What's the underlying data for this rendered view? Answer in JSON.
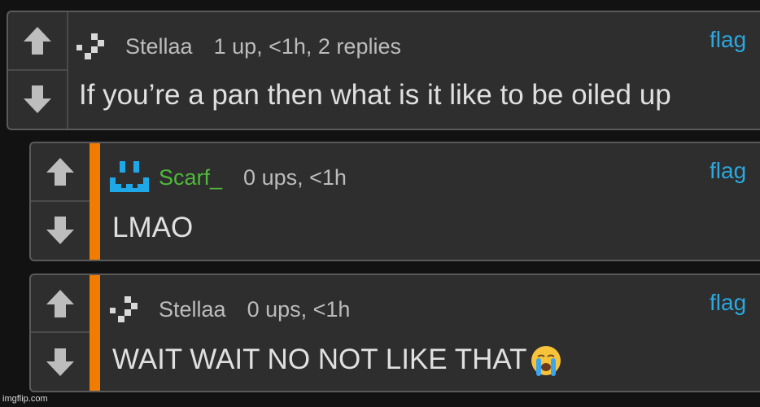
{
  "comments": [
    {
      "username": "Stellaa",
      "meta": "1 up, <1h, 2 replies",
      "flag": "flag",
      "text": "If you’re a pan then what is it like to be oiled up",
      "username_color": "#bcbcbc"
    },
    {
      "username": "Scarf_",
      "meta": "0 ups, <1h",
      "flag": "flag",
      "text": "LMAO",
      "username_color": "#4fb93a"
    },
    {
      "username": "Stellaa",
      "meta": "0 ups, <1h",
      "flag": "flag",
      "text": "WAIT WAIT NO NOT LIKE THAT",
      "emoji": "loudly-crying-face",
      "username_color": "#bcbcbc"
    }
  ],
  "icons": {
    "upvote": "arrow-up-icon",
    "downvote": "arrow-down-icon"
  },
  "colors": {
    "background": "#121212",
    "panel": "#2e2e2e",
    "reply_bar": "#f07c00",
    "flag": "#2aa8e0"
  },
  "watermark": "imgflip.com"
}
